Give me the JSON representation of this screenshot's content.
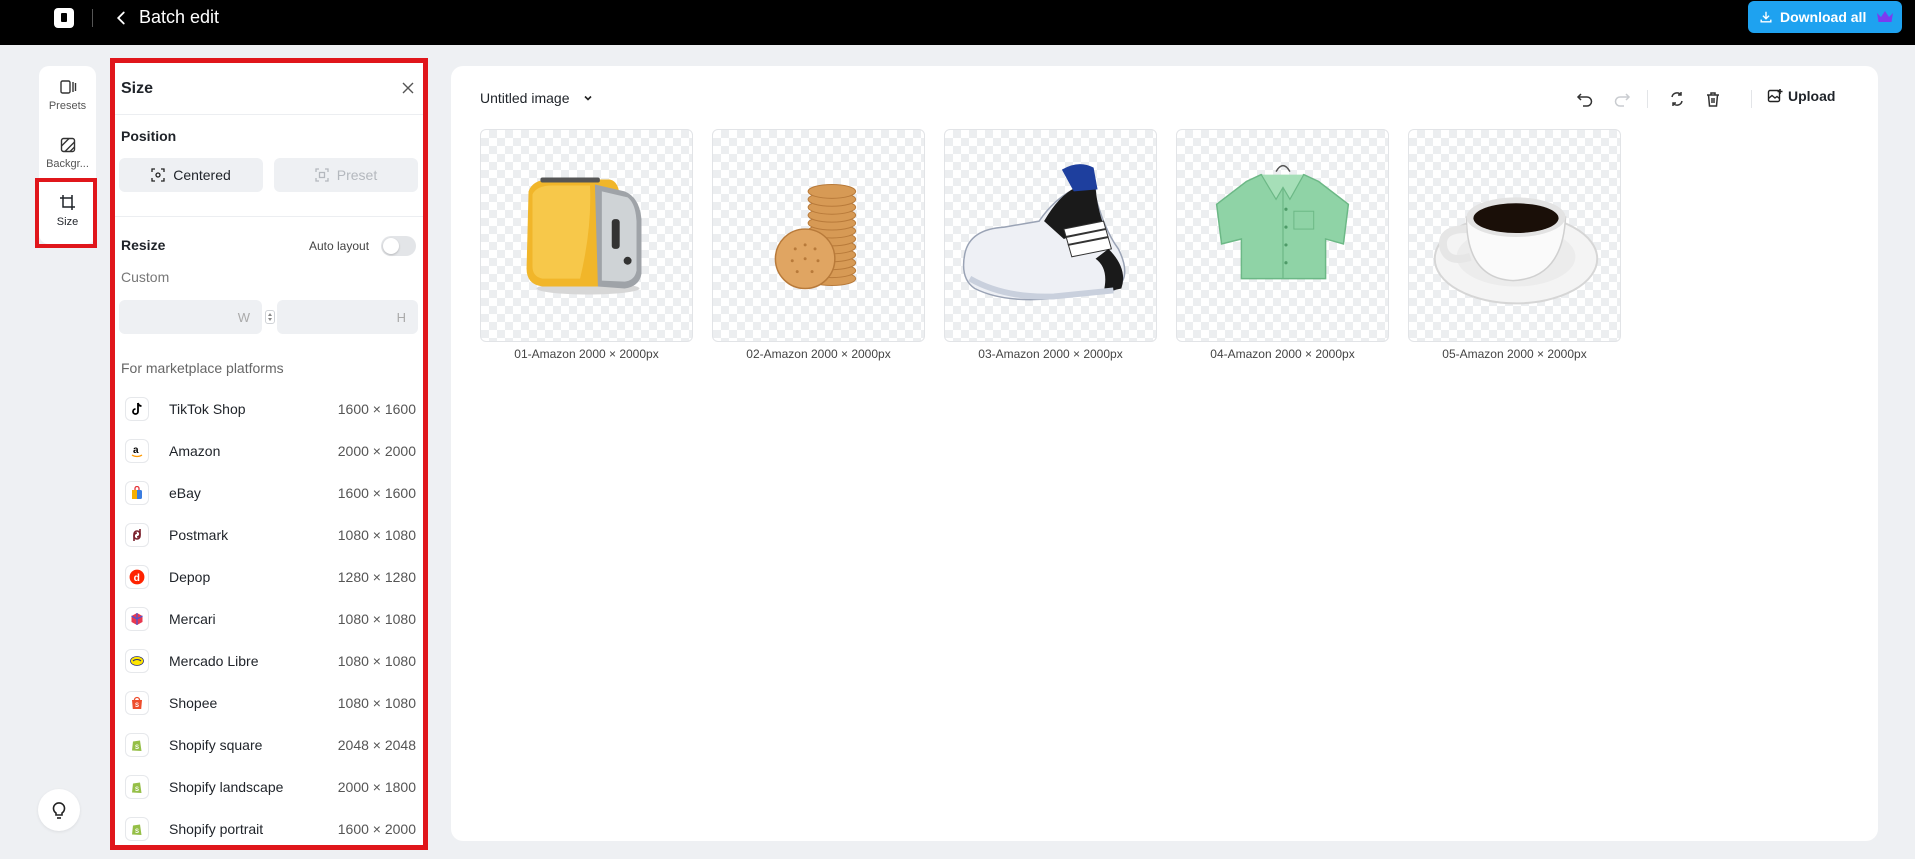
{
  "topbar": {
    "title": "Batch edit",
    "download_label": "Download all"
  },
  "rail": {
    "items": [
      {
        "label": "Presets",
        "icon": "presets-icon"
      },
      {
        "label": "Backgr...",
        "icon": "background-icon"
      },
      {
        "label": "Size",
        "icon": "crop-icon"
      }
    ]
  },
  "panel": {
    "title": "Size",
    "position_label": "Position",
    "centered_label": "Centered",
    "preset_label": "Preset",
    "resize_label": "Resize",
    "auto_layout_label": "Auto layout",
    "custom_label": "Custom",
    "width_placeholder": "W",
    "height_placeholder": "H",
    "marketplace_label": "For marketplace platforms",
    "platforms": [
      {
        "name": "TikTok Shop",
        "size": "1600 × 1600",
        "icon": "tiktok-icon",
        "color": "#000000"
      },
      {
        "name": "Amazon",
        "size": "2000 × 2000",
        "icon": "amazon-icon",
        "color": "#000000"
      },
      {
        "name": "eBay",
        "size": "1600 × 1600",
        "icon": "ebay-icon",
        "color": "#3b7de0"
      },
      {
        "name": "Postmark",
        "size": "1080 × 1080",
        "icon": "poshmark-icon",
        "color": "#7a1f2b"
      },
      {
        "name": "Depop",
        "size": "1280 × 1280",
        "icon": "depop-icon",
        "color": "#ff2300"
      },
      {
        "name": "Mercari",
        "size": "1080 × 1080",
        "icon": "mercari-icon",
        "color": "#e8384f"
      },
      {
        "name": "Mercado Libre",
        "size": "1080 × 1080",
        "icon": "mercadolibre-icon",
        "color": "#ffe600"
      },
      {
        "name": "Shopee",
        "size": "1080 × 1080",
        "icon": "shopee-icon",
        "color": "#ee4d2d"
      },
      {
        "name": "Shopify square",
        "size": "2048 × 2048",
        "icon": "shopify-icon",
        "color": "#95bf47"
      },
      {
        "name": "Shopify landscape",
        "size": "2000 × 1800",
        "icon": "shopify-icon",
        "color": "#95bf47"
      },
      {
        "name": "Shopify portrait",
        "size": "1600 × 2000",
        "icon": "shopify-icon",
        "color": "#95bf47"
      }
    ]
  },
  "canvas": {
    "image_title": "Untitled image",
    "upload_label": "Upload",
    "images": [
      {
        "caption": "01-Amazon 2000 × 2000px",
        "subject": "toaster"
      },
      {
        "caption": "02-Amazon 2000 × 2000px",
        "subject": "crackers"
      },
      {
        "caption": "03-Amazon 2000 × 2000px",
        "subject": "sneaker"
      },
      {
        "caption": "04-Amazon 2000 × 2000px",
        "subject": "shirt"
      },
      {
        "caption": "05-Amazon 2000 × 2000px",
        "subject": "coffee-cup"
      }
    ]
  },
  "colors": {
    "accent": "#1ea2f0",
    "highlight": "#e0161b"
  }
}
